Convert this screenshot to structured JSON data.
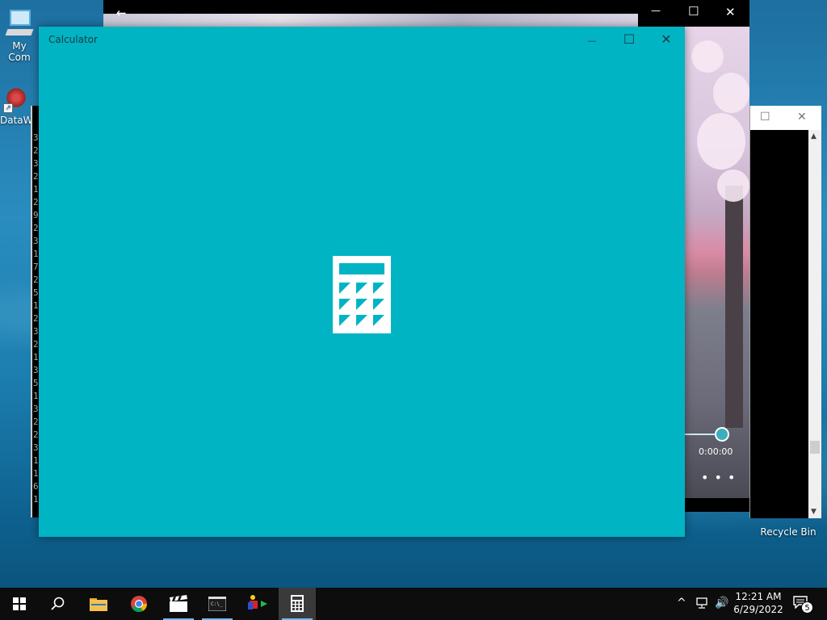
{
  "desktop": {
    "icons": [
      {
        "label": "My Com"
      },
      {
        "label": "DataW"
      },
      {
        "label": "Recycle Bin"
      }
    ]
  },
  "background_windows": {
    "video": {
      "back_glyph": "←",
      "minimize_glyph": "—",
      "maximize_glyph": "☐",
      "close_glyph": "✕",
      "time": "0:00:00",
      "more": "• • •"
    },
    "side": {
      "maximize_glyph": "☐",
      "close_glyph": "✕"
    },
    "terminal": {
      "lines": [
        "3",
        "2",
        "3",
        "2",
        "1",
        "2",
        "9",
        "2",
        "3",
        "1",
        "7",
        "2",
        "5",
        "1",
        "2",
        "3",
        "2",
        "1",
        "3",
        "5",
        "1",
        "3",
        "2",
        "2",
        "3",
        "1",
        "1",
        "6",
        "1"
      ]
    }
  },
  "calculator": {
    "title": "Calculator",
    "minimize_glyph": "—",
    "maximize_glyph": "☐",
    "close_glyph": "✕",
    "background": "#00b4c4"
  },
  "taskbar": {
    "items": [
      {
        "name": "start-button",
        "icon": "windows-logo-icon"
      },
      {
        "name": "search-button",
        "icon": "search-icon"
      },
      {
        "name": "file-explorer-button",
        "icon": "folder-icon"
      },
      {
        "name": "chrome-button",
        "icon": "chrome-icon"
      },
      {
        "name": "movies-tv-button",
        "icon": "clapperboard-icon"
      },
      {
        "name": "terminal-button",
        "icon": "terminal-icon"
      },
      {
        "name": "app-button",
        "icon": "shapes-icon"
      },
      {
        "name": "calculator-button",
        "icon": "calculator-icon"
      }
    ],
    "tray": {
      "chevron": "^",
      "volume_glyph": "🔊",
      "time": "12:21 AM",
      "date": "6/29/2022",
      "notification_count": "5"
    }
  }
}
